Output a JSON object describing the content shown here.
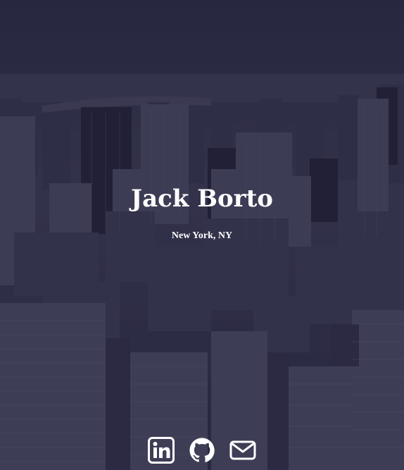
{
  "profile": {
    "name": "Jack Borto",
    "location": "New York, NY"
  },
  "social": [
    {
      "icon": "linkedin-icon"
    },
    {
      "icon": "github-icon"
    },
    {
      "icon": "mail-icon"
    }
  ],
  "colors": {
    "overlay": "#2b2a3f",
    "text": "#ffffff"
  }
}
